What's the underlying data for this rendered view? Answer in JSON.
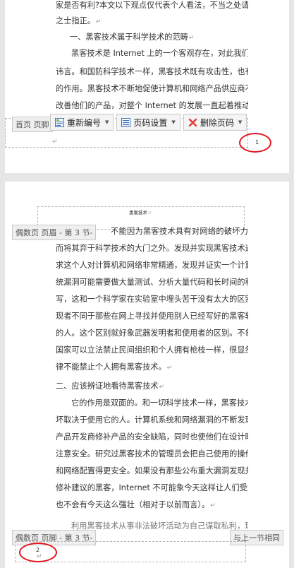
{
  "page1": {
    "lines": [
      "家是否有利?本文以下观点仅代表个人看法，不当之处请有识",
      "之士指正。",
      "一、黑客技术属于科学技术的范畴",
      "黑客技术是 Internet 上的一个客观存在，对此我们无须",
      "讳言。和国防科学技术一样，黑客技术既有攻击性，也有防护",
      "的作用。黑客技术不断地促使计算机和网络产品供应商不断地",
      "改善他们的产品，对整个 Internet 的发展一直起着推动作用。"
    ],
    "footer_tag": "首页 页脚",
    "page_number": "1"
  },
  "toolbar": {
    "renumber_label": "重新编号",
    "page_setup_label": "页码设置",
    "delete_label": "删除页码"
  },
  "page2": {
    "header_title": "黑客技术",
    "header_tag": "偶数页 页眉 - 第 3 节-",
    "lines": [
      "不能因为黑客技术具有对网络的破坏力",
      "而将其弃于科学技术的大门之外。发现并实现黑客技术通常要",
      "求这个人对计算机和网络非常精通，发现并证实一个计算机系",
      "统漏洞可能需要做大量测试、分析大量代码和长时间的程序编",
      "写，这和一个科学家在实验室中埋头苦干没有太大的区别。发",
      "现者不同于那些在网上寻找并使用别人已经写好的黑客软件",
      "的人。这个区别就好象武器发明者和使用者的区别。不象一个",
      "国家可以立法禁止民间组织和个人拥有枪枝一样，很显然，法",
      "律不能禁止个人拥有黑客技术。",
      "二、应该辨证地看待黑客技术",
      "它的作用是双面的。和一切科学技术一样，黑客技术的好",
      "坏取决于使用它的人。计算机系统和网络漏洞的不断发现促使",
      "产品开发商修补产品的安全缺陷，同时也使他们在设计时更加",
      "注意安全。研究过黑客技术的管理员会把自己使用的操作系统",
      "和网络配置得更安全。如果没有那些公布重大漏洞发现并提出",
      "修补建议的黑客，Internet 不可能象今天这样让人们受益，",
      "也不会有今天这么强壮（相对于以前而言）。",
      "利用黑客技术从事非法破坏活动为自己谋取私利，理所当"
    ],
    "footer_tag": "偶数页 页脚 - 第 3 节-",
    "same_as_prev": "与上一节相同",
    "page_number": "2"
  },
  "colors": {
    "highlight_circle": "#e2141b",
    "tag_bg": "#efefef",
    "page_bg": "#ffffff"
  }
}
